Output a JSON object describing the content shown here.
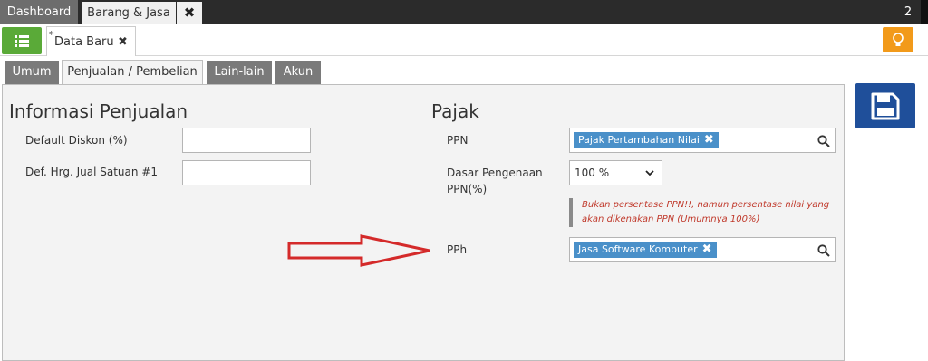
{
  "topbar": {
    "tabs": [
      {
        "label": "Dashboard"
      },
      {
        "label": "Barang & Jasa"
      }
    ],
    "close_symbol": "✖",
    "count": "2"
  },
  "subbar": {
    "data_tab": {
      "star": "*",
      "label": "Data Baru",
      "close_symbol": "✖"
    }
  },
  "tabs": [
    {
      "label": "Umum"
    },
    {
      "label": "Penjualan / Pembelian"
    },
    {
      "label": "Lain-lain"
    },
    {
      "label": "Akun"
    }
  ],
  "left": {
    "heading": "Informasi Penjualan",
    "fields": [
      {
        "label": "Default Diskon (%)",
        "value": ""
      },
      {
        "label": "Def. Hrg. Jual Satuan #1",
        "value": ""
      }
    ]
  },
  "right": {
    "heading": "Pajak",
    "ppn": {
      "label": "PPN",
      "tag": "Pajak Pertambahan Nilai",
      "tag_remove": "✖"
    },
    "dasar": {
      "label_line1": "Dasar Pengenaan",
      "label_line2": "PPN(%)",
      "value": "100 %"
    },
    "note": {
      "line1": "Bukan persentase PPN!!, namun persentase nilai yang",
      "line2": "akan dikenakan PPN (Umumnya 100%)"
    },
    "pph": {
      "label": "PPh",
      "tag": "Jasa Software Komputer",
      "tag_remove": "✖"
    }
  },
  "colors": {
    "accent_green": "#5aaa38",
    "accent_orange": "#f29a1a",
    "save_blue": "#1f4f9a",
    "tag_blue": "#4a90c9",
    "note_red": "#c0392b",
    "arrow_red": "#d42a2a"
  },
  "icons": {
    "menu": "list-icon",
    "bulb": "lightbulb-icon",
    "save": "floppy-disk-icon",
    "search": "search-icon",
    "chevron": "chevron-down-icon",
    "arrow": "arrow-right-icon"
  }
}
